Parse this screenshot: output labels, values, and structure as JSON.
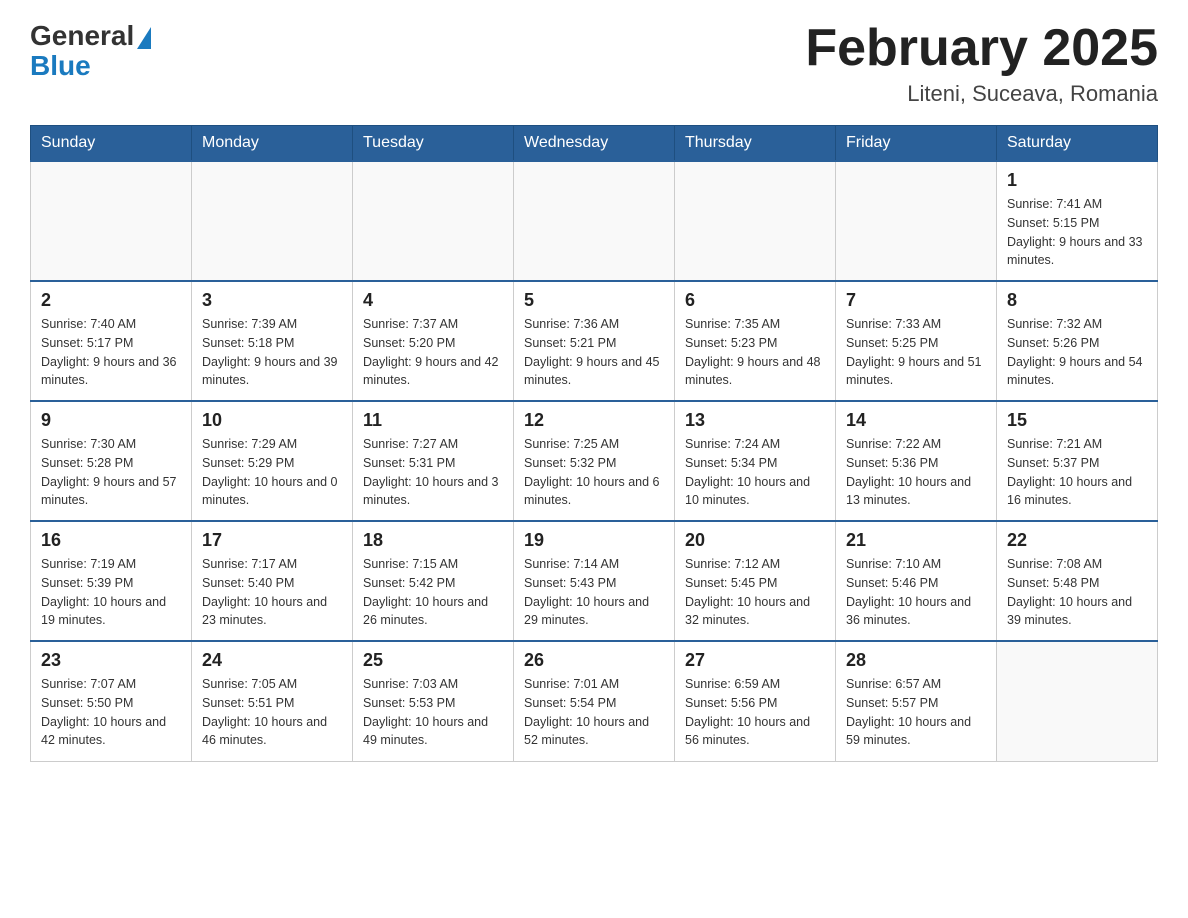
{
  "header": {
    "logo_general": "General",
    "logo_blue": "Blue",
    "month_title": "February 2025",
    "location": "Liteni, Suceava, Romania"
  },
  "days_of_week": [
    "Sunday",
    "Monday",
    "Tuesday",
    "Wednesday",
    "Thursday",
    "Friday",
    "Saturday"
  ],
  "weeks": [
    {
      "days": [
        {
          "num": "",
          "info": ""
        },
        {
          "num": "",
          "info": ""
        },
        {
          "num": "",
          "info": ""
        },
        {
          "num": "",
          "info": ""
        },
        {
          "num": "",
          "info": ""
        },
        {
          "num": "",
          "info": ""
        },
        {
          "num": "1",
          "info": "Sunrise: 7:41 AM\nSunset: 5:15 PM\nDaylight: 9 hours and 33 minutes."
        }
      ]
    },
    {
      "days": [
        {
          "num": "2",
          "info": "Sunrise: 7:40 AM\nSunset: 5:17 PM\nDaylight: 9 hours and 36 minutes."
        },
        {
          "num": "3",
          "info": "Sunrise: 7:39 AM\nSunset: 5:18 PM\nDaylight: 9 hours and 39 minutes."
        },
        {
          "num": "4",
          "info": "Sunrise: 7:37 AM\nSunset: 5:20 PM\nDaylight: 9 hours and 42 minutes."
        },
        {
          "num": "5",
          "info": "Sunrise: 7:36 AM\nSunset: 5:21 PM\nDaylight: 9 hours and 45 minutes."
        },
        {
          "num": "6",
          "info": "Sunrise: 7:35 AM\nSunset: 5:23 PM\nDaylight: 9 hours and 48 minutes."
        },
        {
          "num": "7",
          "info": "Sunrise: 7:33 AM\nSunset: 5:25 PM\nDaylight: 9 hours and 51 minutes."
        },
        {
          "num": "8",
          "info": "Sunrise: 7:32 AM\nSunset: 5:26 PM\nDaylight: 9 hours and 54 minutes."
        }
      ]
    },
    {
      "days": [
        {
          "num": "9",
          "info": "Sunrise: 7:30 AM\nSunset: 5:28 PM\nDaylight: 9 hours and 57 minutes."
        },
        {
          "num": "10",
          "info": "Sunrise: 7:29 AM\nSunset: 5:29 PM\nDaylight: 10 hours and 0 minutes."
        },
        {
          "num": "11",
          "info": "Sunrise: 7:27 AM\nSunset: 5:31 PM\nDaylight: 10 hours and 3 minutes."
        },
        {
          "num": "12",
          "info": "Sunrise: 7:25 AM\nSunset: 5:32 PM\nDaylight: 10 hours and 6 minutes."
        },
        {
          "num": "13",
          "info": "Sunrise: 7:24 AM\nSunset: 5:34 PM\nDaylight: 10 hours and 10 minutes."
        },
        {
          "num": "14",
          "info": "Sunrise: 7:22 AM\nSunset: 5:36 PM\nDaylight: 10 hours and 13 minutes."
        },
        {
          "num": "15",
          "info": "Sunrise: 7:21 AM\nSunset: 5:37 PM\nDaylight: 10 hours and 16 minutes."
        }
      ]
    },
    {
      "days": [
        {
          "num": "16",
          "info": "Sunrise: 7:19 AM\nSunset: 5:39 PM\nDaylight: 10 hours and 19 minutes."
        },
        {
          "num": "17",
          "info": "Sunrise: 7:17 AM\nSunset: 5:40 PM\nDaylight: 10 hours and 23 minutes."
        },
        {
          "num": "18",
          "info": "Sunrise: 7:15 AM\nSunset: 5:42 PM\nDaylight: 10 hours and 26 minutes."
        },
        {
          "num": "19",
          "info": "Sunrise: 7:14 AM\nSunset: 5:43 PM\nDaylight: 10 hours and 29 minutes."
        },
        {
          "num": "20",
          "info": "Sunrise: 7:12 AM\nSunset: 5:45 PM\nDaylight: 10 hours and 32 minutes."
        },
        {
          "num": "21",
          "info": "Sunrise: 7:10 AM\nSunset: 5:46 PM\nDaylight: 10 hours and 36 minutes."
        },
        {
          "num": "22",
          "info": "Sunrise: 7:08 AM\nSunset: 5:48 PM\nDaylight: 10 hours and 39 minutes."
        }
      ]
    },
    {
      "days": [
        {
          "num": "23",
          "info": "Sunrise: 7:07 AM\nSunset: 5:50 PM\nDaylight: 10 hours and 42 minutes."
        },
        {
          "num": "24",
          "info": "Sunrise: 7:05 AM\nSunset: 5:51 PM\nDaylight: 10 hours and 46 minutes."
        },
        {
          "num": "25",
          "info": "Sunrise: 7:03 AM\nSunset: 5:53 PM\nDaylight: 10 hours and 49 minutes."
        },
        {
          "num": "26",
          "info": "Sunrise: 7:01 AM\nSunset: 5:54 PM\nDaylight: 10 hours and 52 minutes."
        },
        {
          "num": "27",
          "info": "Sunrise: 6:59 AM\nSunset: 5:56 PM\nDaylight: 10 hours and 56 minutes."
        },
        {
          "num": "28",
          "info": "Sunrise: 6:57 AM\nSunset: 5:57 PM\nDaylight: 10 hours and 59 minutes."
        },
        {
          "num": "",
          "info": ""
        }
      ]
    }
  ]
}
